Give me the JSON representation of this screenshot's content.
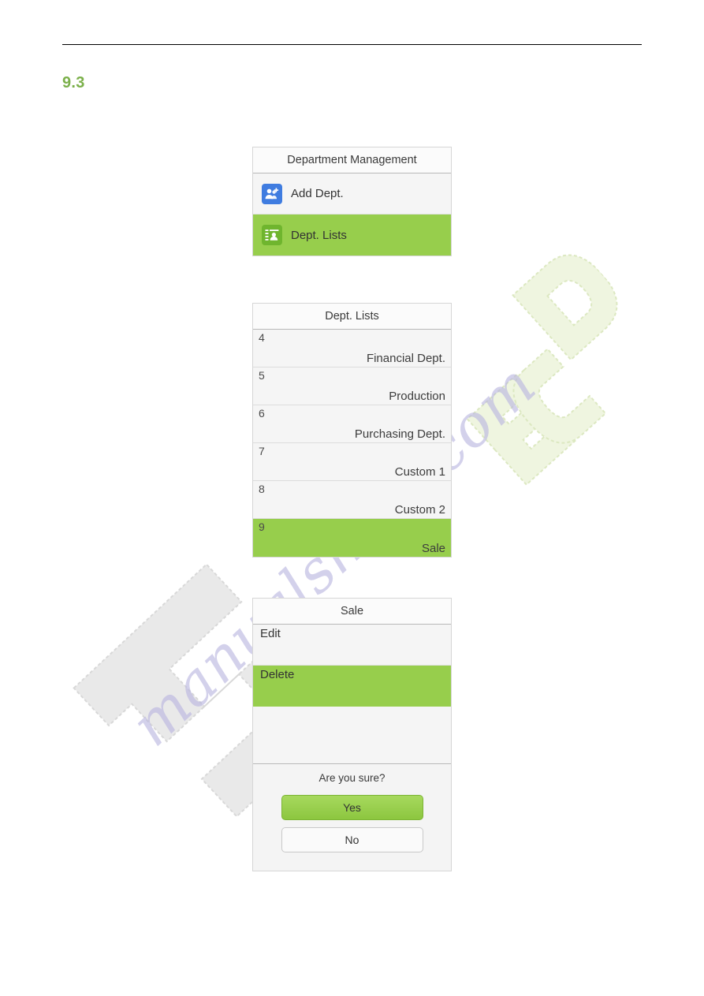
{
  "document": {
    "section_number": "9.3"
  },
  "panels": {
    "department_management": {
      "title": "Department Management",
      "items": [
        {
          "icon": "add-users-icon",
          "label": "Add Dept.",
          "selected": false
        },
        {
          "icon": "dept-list-icon",
          "label": "Dept. Lists",
          "selected": true
        }
      ]
    },
    "dept_lists": {
      "title": "Dept. Lists",
      "rows": [
        {
          "id": "4",
          "name": "Financial Dept.",
          "selected": false
        },
        {
          "id": "5",
          "name": "Production",
          "selected": false
        },
        {
          "id": "6",
          "name": "Purchasing Dept.",
          "selected": false
        },
        {
          "id": "7",
          "name": "Custom 1",
          "selected": false
        },
        {
          "id": "8",
          "name": "Custom 2",
          "selected": false
        },
        {
          "id": "9",
          "name": "Sale",
          "selected": true
        }
      ]
    },
    "sale_actions": {
      "title": "Sale",
      "items": [
        {
          "label": "Edit",
          "selected": false
        },
        {
          "label": "Delete",
          "selected": true
        }
      ]
    },
    "confirm_dialog": {
      "message": "Are you sure?",
      "yes_label": "Yes",
      "no_label": "No"
    }
  },
  "watermarks": {
    "site_text": "manualshive.com",
    "logo_text": "ECD"
  },
  "colors": {
    "accent_green": "#97ce4c",
    "heading_green": "#7bb04a",
    "icon_blue": "#3f7ce0",
    "icon_green": "#6fb52e",
    "panel_bg": "#f5f5f5",
    "panel_border": "#d6d6d6"
  }
}
